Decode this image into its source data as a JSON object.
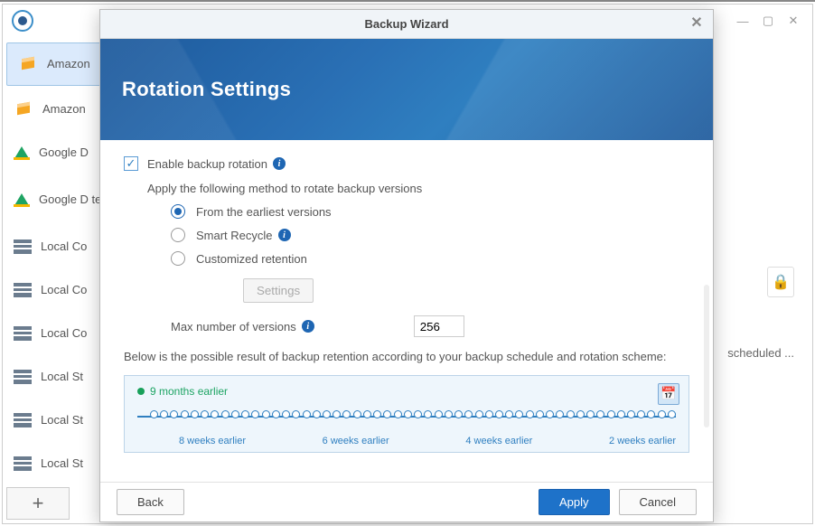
{
  "window": {
    "controls": {
      "minimize": "—",
      "maximize": "▢",
      "close": "✕"
    }
  },
  "sidebar": {
    "items": [
      {
        "label": "Amazon",
        "icon": "cube"
      },
      {
        "label": "Amazon",
        "icon": "cube"
      },
      {
        "label": "Google D",
        "icon": "drive"
      },
      {
        "label": "Google D test",
        "icon": "drive",
        "tall": true
      },
      {
        "label": "Local Co",
        "icon": "server"
      },
      {
        "label": "Local Co",
        "icon": "server"
      },
      {
        "label": "Local Co",
        "icon": "server"
      },
      {
        "label": "Local St",
        "icon": "server"
      },
      {
        "label": "Local St",
        "icon": "server"
      },
      {
        "label": "Local St",
        "icon": "server"
      }
    ],
    "add": "+"
  },
  "bg": {
    "status": "scheduled ...",
    "lock": "🔒"
  },
  "modal": {
    "title": "Backup Wizard",
    "heading": "Rotation Settings",
    "enable_label": "Enable backup rotation",
    "apply_text": "Apply the following method to rotate backup versions",
    "radios": {
      "earliest": "From the earliest versions",
      "smart": "Smart Recycle",
      "custom": "Customized retention"
    },
    "settings_btn": "Settings",
    "max_label": "Max number of versions",
    "max_value": "256",
    "desc": "Below is the possible result of backup retention according to your backup schedule and rotation scheme:",
    "timeline": {
      "oldest": "9 months earlier",
      "ticks": [
        "8 weeks earlier",
        "6 weeks earlier",
        "4 weeks earlier",
        "2 weeks earlier"
      ]
    },
    "buttons": {
      "back": "Back",
      "apply": "Apply",
      "cancel": "Cancel"
    }
  }
}
